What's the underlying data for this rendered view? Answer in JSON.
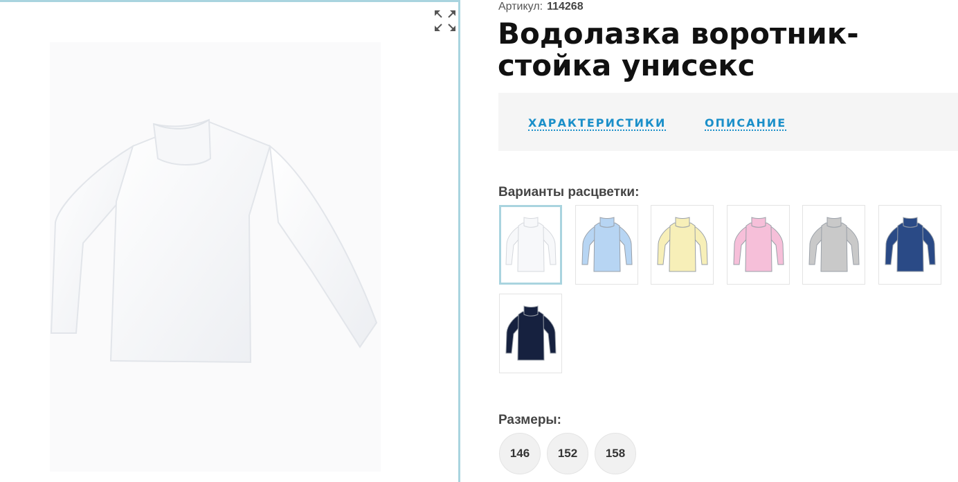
{
  "product": {
    "article_label": "Артикул:",
    "article_value": "114268",
    "title": "Водолазка воротник-стойка унисекс"
  },
  "gallery": {
    "fullscreen_icon": "expand-arrows-icon"
  },
  "tabs": [
    {
      "label": "ХАРАКТЕРИСТИКИ"
    },
    {
      "label": "ОПИСАНИЕ"
    }
  ],
  "colors": {
    "label": "Варианты расцветки:",
    "swatches": [
      {
        "name": "white",
        "color": "#f7f8fa",
        "selected": true
      },
      {
        "name": "light-blue",
        "color": "#b7d5f3",
        "selected": false
      },
      {
        "name": "cream",
        "color": "#f7efb8",
        "selected": false
      },
      {
        "name": "pink",
        "color": "#f6bfd9",
        "selected": false
      },
      {
        "name": "grey",
        "color": "#c9c9c9",
        "selected": false
      },
      {
        "name": "blue",
        "color": "#2a4a86",
        "selected": false
      },
      {
        "name": "navy",
        "color": "#16213f",
        "selected": false
      }
    ]
  },
  "sizes": {
    "label": "Размеры:",
    "options": [
      "146",
      "152",
      "158"
    ]
  }
}
